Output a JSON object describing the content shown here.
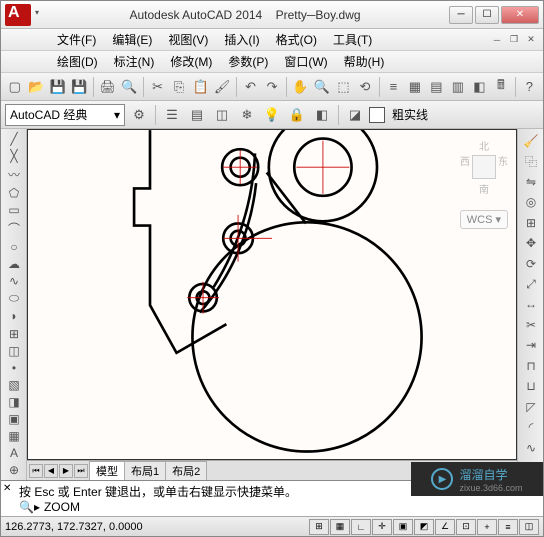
{
  "title": {
    "app": "Autodesk AutoCAD 2014",
    "file": "Pretty─Boy.dwg"
  },
  "menus1": [
    {
      "label": "文件(F)"
    },
    {
      "label": "编辑(E)"
    },
    {
      "label": "视图(V)"
    },
    {
      "label": "插入(I)"
    },
    {
      "label": "格式(O)"
    },
    {
      "label": "工具(T)"
    }
  ],
  "menus2": [
    {
      "label": "绘图(D)"
    },
    {
      "label": "标注(N)"
    },
    {
      "label": "修改(M)"
    },
    {
      "label": "参数(P)"
    },
    {
      "label": "窗口(W)"
    },
    {
      "label": "帮助(H)"
    }
  ],
  "workspace": "AutoCAD 经典",
  "linetype": "粗实线",
  "wcs": "WCS",
  "navcube": {
    "top": "北",
    "left": "西",
    "right": "东",
    "bottom": "南"
  },
  "tabs": {
    "model": "模型",
    "layout1": "布局1",
    "layout2": "布局2"
  },
  "cmd": {
    "line1": "按 Esc 或 Enter 键退出，或单击右键显示快捷菜单。",
    "prompt": "ZOOM"
  },
  "watermark": {
    "text": "溜溜自学",
    "url": "zixue.3d66.com"
  },
  "status": {
    "coords": "126.2773, 172.7327, 0.0000"
  }
}
